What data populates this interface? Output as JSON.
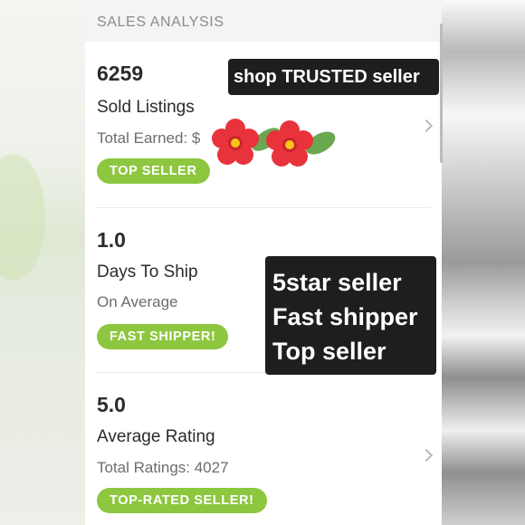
{
  "header": {
    "title": "SALES ANALYSIS"
  },
  "stats": [
    {
      "value": "6259",
      "label": "Sold Listings",
      "sub": "Total Earned: $",
      "badge": "TOP SELLER"
    },
    {
      "value": "1.0",
      "label": "Days To Ship",
      "sub": "On Average",
      "badge": "FAST SHIPPER!"
    },
    {
      "value": "5.0",
      "label": "Average Rating",
      "sub": "Total Ratings: 4027",
      "badge": "TOP-RATED SELLER!"
    }
  ],
  "overlays": {
    "trusted": "shop TRUSTED seller",
    "seller_lines": [
      "5star seller",
      "Fast shipper",
      "Top seller"
    ]
  },
  "colors": {
    "badge_green": "#8dc63f",
    "overlay_bg": "#1e1e1e",
    "flower_red": "#e8333c",
    "leaf_green": "#6aa84f"
  },
  "icons": [
    "chevron-right-icon",
    "flower-icon"
  ]
}
